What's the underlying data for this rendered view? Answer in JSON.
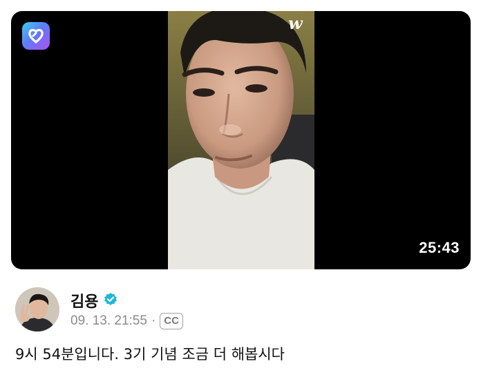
{
  "video": {
    "duration": "25:43",
    "watermark": "w",
    "app_icon": "weverse-heart-icon"
  },
  "post": {
    "author_name": "김용",
    "verified_icon": "verified-badge-icon",
    "timestamp": "09. 13. 21:55",
    "separator": "·",
    "cc_label": "CC",
    "text": "9시 54분입니다. 3기 기념 조금 더 해봅시다"
  },
  "colors": {
    "video_background": "#000000",
    "verified": "#1fb8d6",
    "meta_text": "#8a8a8a",
    "body_text": "#111111"
  }
}
